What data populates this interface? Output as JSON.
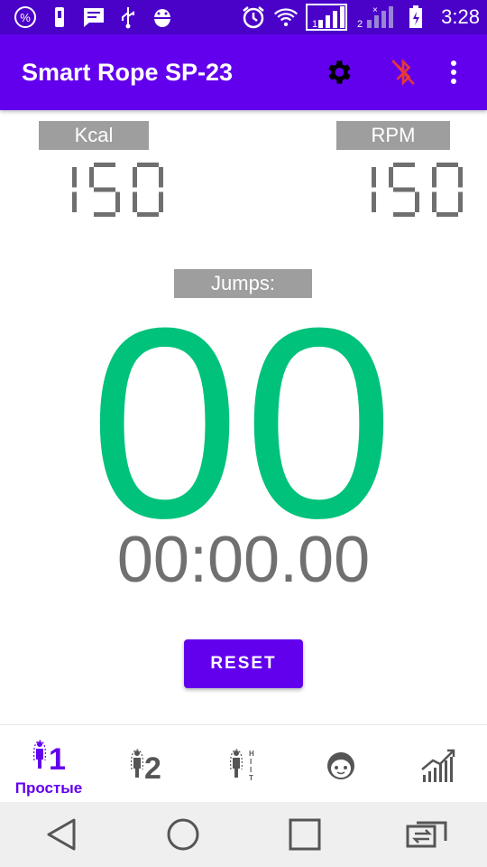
{
  "status_bar": {
    "time": "3:28",
    "icons": [
      "percent-icon",
      "usb-icon",
      "message-icon",
      "usb-plug-icon",
      "android-debug-icon",
      "alarm-icon",
      "wifi-icon",
      "signal-sim1-icon",
      "signal-sim2-icon",
      "battery-charging-icon"
    ]
  },
  "app_bar": {
    "title": "Smart Rope SP-23",
    "actions": [
      "settings-icon",
      "bluetooth-disabled-icon",
      "more-vert-icon"
    ],
    "accent": "#6200ee",
    "bluetooth_color": "#e53935"
  },
  "stats": {
    "kcal": {
      "label": "Kcal",
      "value": "150"
    },
    "rpm": {
      "label": "RPM",
      "value": "150"
    }
  },
  "jumps": {
    "label": "Jumps:",
    "value": "00",
    "color": "#00c27a"
  },
  "timer": "00:00.00",
  "reset_label": "RESET",
  "bottom_nav": {
    "items": [
      {
        "icon": "jumper-1-icon",
        "label": "Простые",
        "active": true
      },
      {
        "icon": "jumper-2-icon",
        "label": "",
        "active": false
      },
      {
        "icon": "jumper-hiit-icon",
        "label": "",
        "active": false
      },
      {
        "icon": "face-icon",
        "label": "",
        "active": false
      },
      {
        "icon": "stats-chart-icon",
        "label": "",
        "active": false
      }
    ]
  },
  "system_nav": [
    "back-icon",
    "home-icon",
    "recents-icon",
    "switch-app-icon"
  ]
}
